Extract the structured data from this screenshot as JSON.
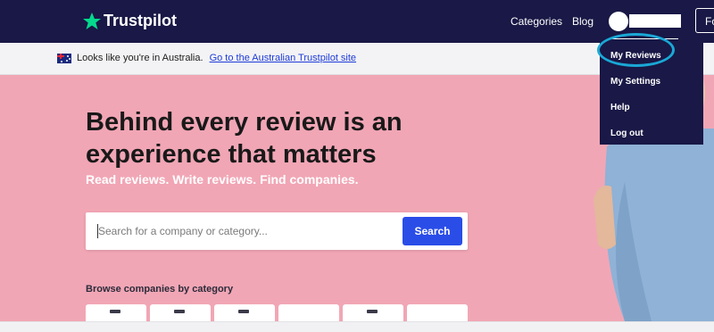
{
  "nav": {
    "logo_text": "Trustpilot",
    "categories_label": "Categories",
    "blog_label": "Blog",
    "for_business_label": "Fo"
  },
  "location_bar": {
    "message": "Looks like you're in Australia.",
    "link_text": "Go to the Australian Trustpilot site"
  },
  "hero": {
    "headline": "Behind every review is an experience that matters",
    "subline": "Read reviews. Write reviews. Find companies.",
    "search": {
      "placeholder": "Search for a company or category...",
      "value": "",
      "button_label": "Search"
    },
    "browse_title": "Browse companies by category"
  },
  "user_menu": {
    "items": [
      {
        "label": "My Reviews"
      },
      {
        "label": "My Settings"
      },
      {
        "label": "Help"
      },
      {
        "label": "Log out"
      }
    ]
  },
  "colors": {
    "nav_bg": "#191846",
    "hero_bg": "#f1a6b5",
    "accent_blue": "#2a4de8",
    "logo_star": "#04da8d",
    "highlight": "#1aa8d6"
  },
  "icons": {
    "logo": "star-icon",
    "flag": "australia-flag-icon"
  }
}
